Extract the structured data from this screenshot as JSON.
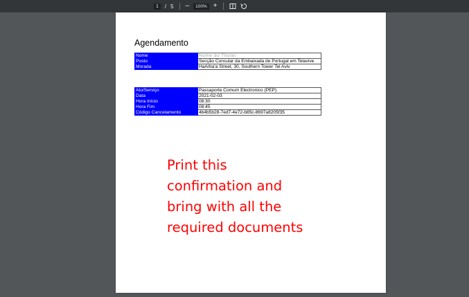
{
  "toolbar": {
    "current_page": "1",
    "page_sep": "/",
    "total_pages": "5",
    "zoom_out": "–",
    "zoom_level": "100%",
    "zoom_in": "+",
    "fit_icon": "fit-page-icon",
    "rotate_icon": "rotate-icon"
  },
  "document": {
    "title": "Agendamento",
    "table1": [
      {
        "label": "Nome",
        "value": "Nome do Titular"
      },
      {
        "label": "Posto",
        "value": "Secção Consular da Embaixada de Portugal em Telavive"
      },
      {
        "label": "Morada",
        "value": "HaArba'a Street, 30, Southern Tower Tel Aviv"
      }
    ],
    "table2": [
      {
        "label": "Ato/Serviço",
        "value": "Passaporte Comum Electronico (PEP)"
      },
      {
        "label": "Data",
        "value": "2021-02-03"
      },
      {
        "label": "Hora Início",
        "value": "08:30"
      },
      {
        "label": "Hora Fim",
        "value": "08:45"
      },
      {
        "label": "Código Cancelamento",
        "value": "4b4b5b28-7ed7-4e72-b85c-8697a8205f35"
      }
    ],
    "note_lines": [
      "Print this",
      "confirmation and",
      "bring with all the",
      "required documents"
    ]
  },
  "colors": {
    "label_bg": "#0000ff",
    "note": "#ff0000",
    "viewer_bg": "#525659",
    "toolbar_bg": "#323639"
  }
}
